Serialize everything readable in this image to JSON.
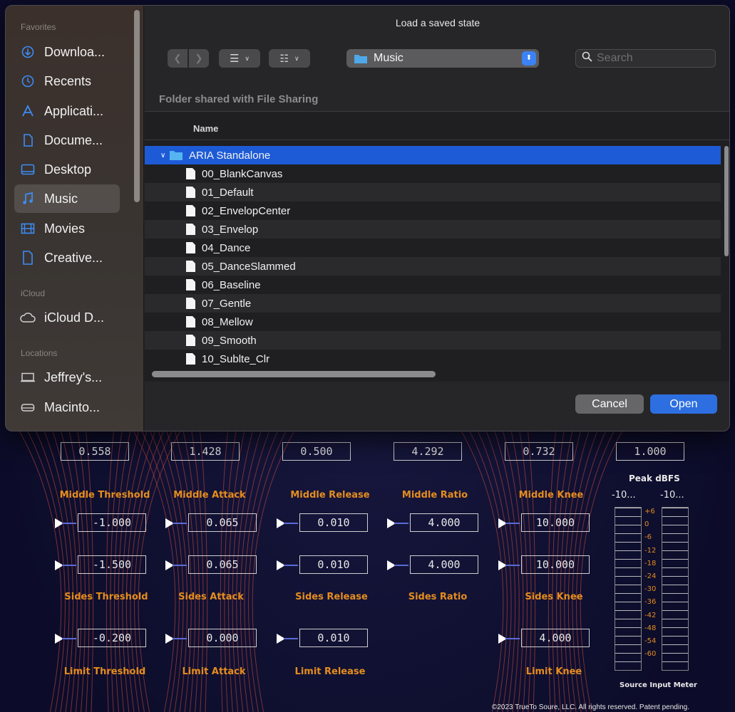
{
  "dialog": {
    "title": "Load a saved state",
    "location": "Music",
    "search_placeholder": "Search",
    "shared_label": "Folder shared with File Sharing",
    "column_name": "Name",
    "cancel_label": "Cancel",
    "open_label": "Open",
    "folder": "ARIA Standalone",
    "files": [
      "00_BlankCanvas",
      "01_Default",
      "02_EnvelopCenter",
      "03_Envelop",
      "04_Dance",
      "05_DanceSlammed",
      "06_Baseline",
      "07_Gentle",
      "08_Mellow",
      "09_Smooth",
      "10_Sublte_Clr"
    ]
  },
  "sidebar": {
    "favorites_heading": "Favorites",
    "favorites": [
      {
        "label": "Downloa...",
        "icon": "download-icon"
      },
      {
        "label": "Recents",
        "icon": "clock-icon"
      },
      {
        "label": "Applicati...",
        "icon": "applications-icon"
      },
      {
        "label": "Docume...",
        "icon": "document-icon"
      },
      {
        "label": "Desktop",
        "icon": "desktop-icon"
      },
      {
        "label": "Music",
        "icon": "music-icon",
        "selected": true
      },
      {
        "label": "Movies",
        "icon": "film-icon"
      },
      {
        "label": "Creative...",
        "icon": "document-icon"
      }
    ],
    "icloud_heading": "iCloud",
    "icloud": [
      {
        "label": "iCloud D...",
        "icon": "cloud-icon"
      }
    ],
    "locations_heading": "Locations",
    "locations": [
      {
        "label": "Jeffrey's...",
        "icon": "laptop-icon"
      },
      {
        "label": "Macinto...",
        "icon": "drive-icon"
      }
    ]
  },
  "plugin": {
    "top_values": [
      "0.558",
      "1.428",
      "0.500",
      "4.292",
      "0.732",
      "1.000"
    ],
    "middle_labels": [
      "Middle Threshold",
      "Middle Attack",
      "Middle Release",
      "Middle Ratio",
      "Middle Knee"
    ],
    "middle_values": [
      "-1.000",
      "0.065",
      "0.010",
      "4.000",
      "10.000"
    ],
    "sides_values": [
      "-1.500",
      "0.065",
      "0.010",
      "4.000",
      "10.000"
    ],
    "sides_labels": [
      "Sides Threshold",
      "Sides Attack",
      "Sides Release",
      "Sides Ratio",
      "Sides Knee"
    ],
    "limit_values": [
      "-0.200",
      "0.000",
      "0.010",
      "4.000"
    ],
    "limit_labels": [
      "Limit Threshold",
      "Limit Attack",
      "Limit Release",
      "Limit Knee"
    ],
    "meter_title": "Peak dBFS",
    "meter_left_readout": "-10...",
    "meter_right_readout": "-10...",
    "meter_scale": [
      "+6",
      "0",
      "-6",
      "-12",
      "-18",
      "-24",
      "-30",
      "-36",
      "-42",
      "-48",
      "-54",
      "-60"
    ],
    "meter_caption": "Source Input Meter",
    "copyright": "©2023 TrueTo Soure, LLC. All rights reserved. Patent pending.",
    "accent_color": "#e58d1e"
  }
}
